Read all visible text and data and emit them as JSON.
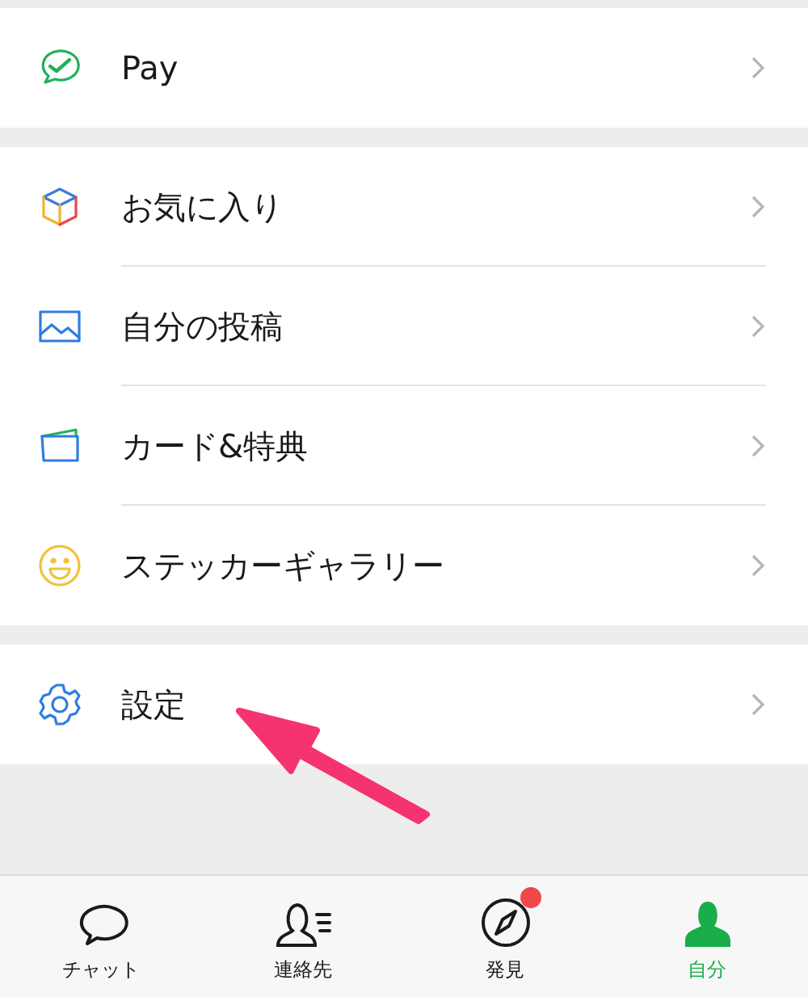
{
  "sections": [
    {
      "items": [
        {
          "label": "Pay"
        }
      ]
    },
    {
      "items": [
        {
          "label": "お気に入り"
        },
        {
          "label": "自分の投稿"
        },
        {
          "label": "カード&特典"
        },
        {
          "label": "ステッカーギャラリー"
        }
      ]
    },
    {
      "items": [
        {
          "label": "設定"
        }
      ]
    }
  ],
  "tab_bar": [
    {
      "label": "チャット",
      "selected": false,
      "badge": false
    },
    {
      "label": "連絡先",
      "selected": false,
      "badge": false
    },
    {
      "label": "発見",
      "selected": false,
      "badge": true
    },
    {
      "label": "自分",
      "selected": true,
      "badge": false
    }
  ]
}
